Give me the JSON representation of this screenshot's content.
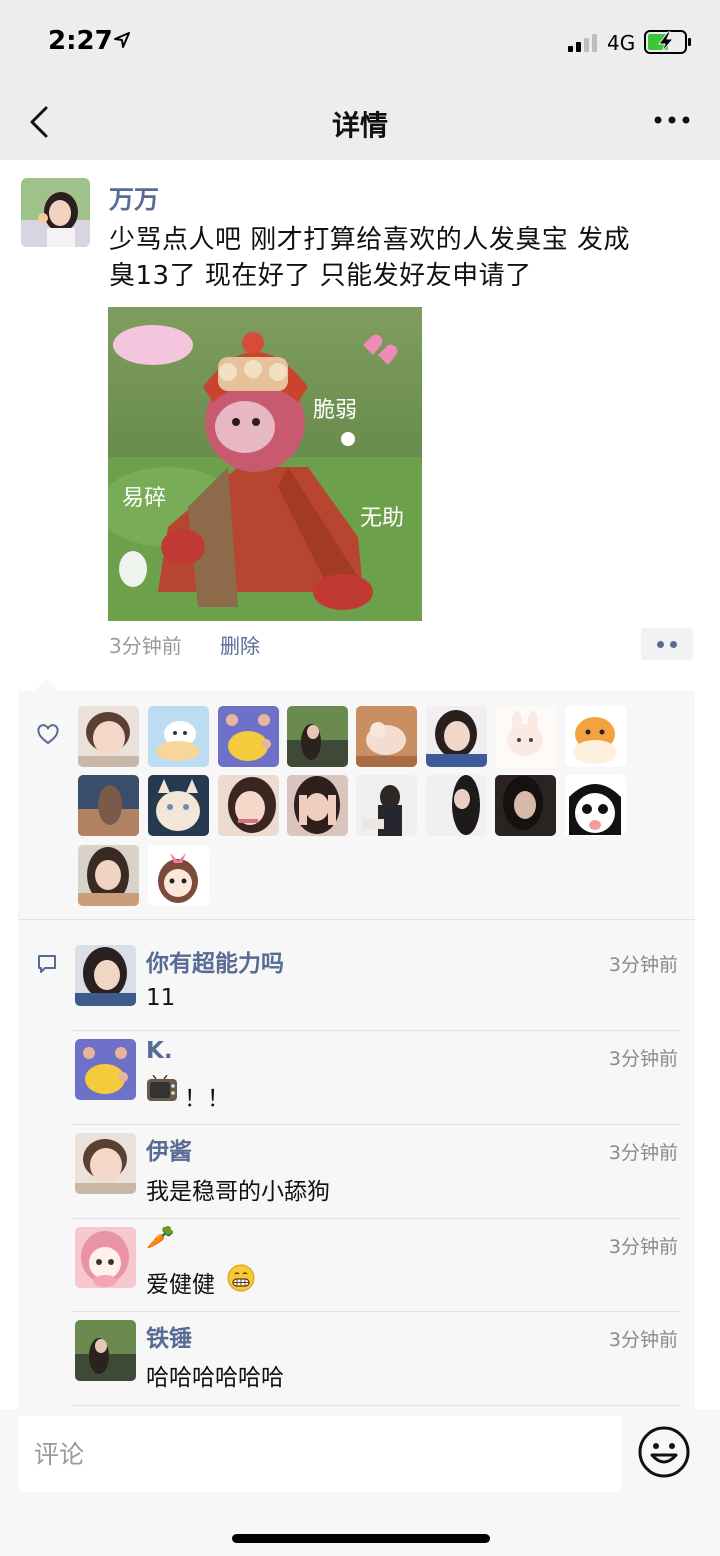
{
  "status_bar": {
    "time": "2:27",
    "network": "4G"
  },
  "nav": {
    "title": "详情"
  },
  "post": {
    "author": "万万",
    "text_line1": "少骂点人吧 刚才打算给喜欢的人发臭宝 发成",
    "text_line2": "臭13了 现在好了 只能发好友申请了",
    "image_labels": {
      "a": "脆弱",
      "b": "易碎",
      "c": "无助"
    },
    "time": "3分钟前",
    "delete_label": "删除"
  },
  "comments": [
    {
      "name": "你有超能力吗",
      "time": "3分钟前",
      "text": "11"
    },
    {
      "name": "K.",
      "time": "3分钟前",
      "text": "！！"
    },
    {
      "name": "伊酱",
      "time": "3分钟前",
      "text": "我是稳哥的小舔狗"
    },
    {
      "name": "🥕",
      "time": "3分钟前",
      "text": "爱健健"
    },
    {
      "name": "铁锤",
      "time": "3分钟前",
      "text": "哈哈哈哈哈哈"
    }
  ],
  "comment_input": {
    "placeholder": "评论"
  },
  "colors": {
    "link": "#576b95",
    "nav_bg": "#ededed",
    "panel_bg": "#f7f7f7"
  }
}
